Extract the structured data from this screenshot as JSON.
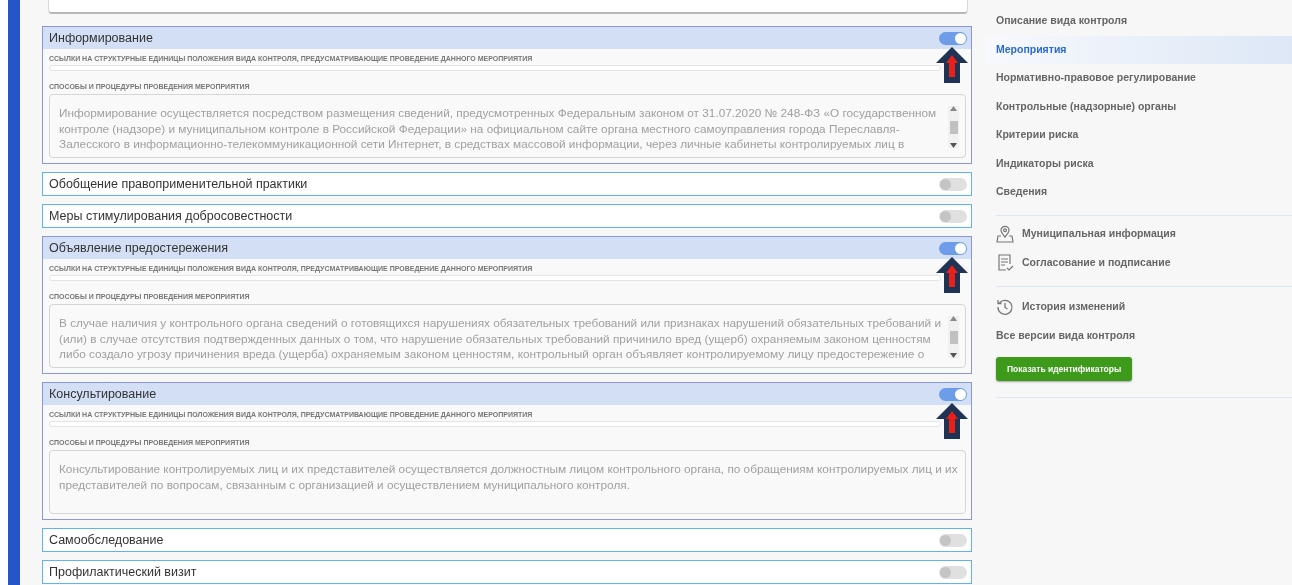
{
  "activities": [
    {
      "title": "Информирование",
      "enabled": true,
      "pointer_arrow": true,
      "refs_label": "ССЫЛКИ НА СТРУКТУРНЫЕ ЕДИНИЦЫ ПОЛОЖЕНИЯ ВИДА КОНТРОЛЯ, ПРЕДУСМАТРИВАЮЩИЕ ПРОВЕДЕНИЕ ДАННОГО МЕРОПРИЯТИЯ",
      "methods_label": "СПОСОБЫ И ПРОЦЕДУРЫ ПРОВЕДЕНИЯ МЕРОПРИЯТИЯ",
      "methods_lines": [
        "Информирование осуществляется посредством размещения сведений, предусмотренных Федеральным законом от 31.07.2020 № 248-ФЗ «О государственном",
        "контроле (надзоре) и муниципальном контроле в Российской Федерации» на официальном сайте органа местного самоуправления города Переславля-",
        "Залесского в информационно-телекоммуникационной сети Интернет, в средствах массовой информации, через личные кабинеты контролируемых лиц в"
      ],
      "scrollable": true
    },
    {
      "title": "Обобщение правоприменительной практики",
      "enabled": false
    },
    {
      "title": "Меры стимулирования добросовестности",
      "enabled": false
    },
    {
      "title": "Объявление предостережения",
      "enabled": true,
      "pointer_arrow": true,
      "refs_label": "ССЫЛКИ НА СТРУКТУРНЫЕ ЕДИНИЦЫ ПОЛОЖЕНИЯ ВИДА КОНТРОЛЯ, ПРЕДУСМАТРИВАЮЩИЕ ПРОВЕДЕНИЕ ДАННОГО МЕРОПРИЯТИЯ",
      "methods_label": "СПОСОБЫ И ПРОЦЕДУРЫ ПРОВЕДЕНИЯ МЕРОПРИЯТИЯ",
      "methods_lines": [
        "В случае наличия у контрольного органа сведений о готовящихся нарушениях обязательных требований или признаках нарушений обязательных требований и",
        "(или) в случае отсутствия подтвержденных данных о том, что нарушение обязательных требований причинило вред (ущерб) охраняемым законом ценностям",
        "либо создало угрозу причинения вреда (ущерба) охраняемым законом ценностям, контрольный орган объявляет контролируемому лицу предостережение о"
      ],
      "scrollable": true
    },
    {
      "title": "Консультирование",
      "enabled": true,
      "pointer_arrow": true,
      "refs_label": "ССЫЛКИ НА СТРУКТУРНЫЕ ЕДИНИЦЫ ПОЛОЖЕНИЯ ВИДА КОНТРОЛЯ, ПРЕДУСМАТРИВАЮЩИЕ ПРОВЕДЕНИЕ ДАННОГО МЕРОПРИЯТИЯ",
      "methods_label": "СПОСОБЫ И ПРОЦЕДУРЫ ПРОВЕДЕНИЯ МЕРОПРИЯТИЯ",
      "methods_lines": [
        "Консультирование контролируемых лиц и их представителей осуществляется должностным лицом контрольного органа, по обращениям контролируемых лиц и их",
        "представителей по вопросам, связанным с организацией и осуществлением муниципального контроля."
      ],
      "scrollable": false
    },
    {
      "title": "Самообследование",
      "enabled": false
    },
    {
      "title": "Профилактический визит",
      "enabled": false
    }
  ],
  "sidebar": {
    "sections": [
      {
        "title": "Описание вида контроля",
        "selected": false
      },
      {
        "title": "Мероприятия",
        "selected": true
      },
      {
        "title": "Нормативно-правовое регулирование",
        "selected": false
      },
      {
        "title": "Контрольные (надзорные) органы",
        "selected": false
      },
      {
        "title": "Критерии риска",
        "selected": false
      },
      {
        "title": "Индикаторы риска",
        "selected": false
      },
      {
        "title": "Сведения",
        "selected": false
      }
    ],
    "links": [
      {
        "kind": "map",
        "label": "Муниципальная информация"
      },
      {
        "kind": "sign",
        "label": "Согласование и подписание"
      }
    ],
    "history": {
      "kind": "history",
      "label": "История изменений"
    },
    "versions": "Все версии вида контроля",
    "button": "Показать идентификаторы"
  }
}
